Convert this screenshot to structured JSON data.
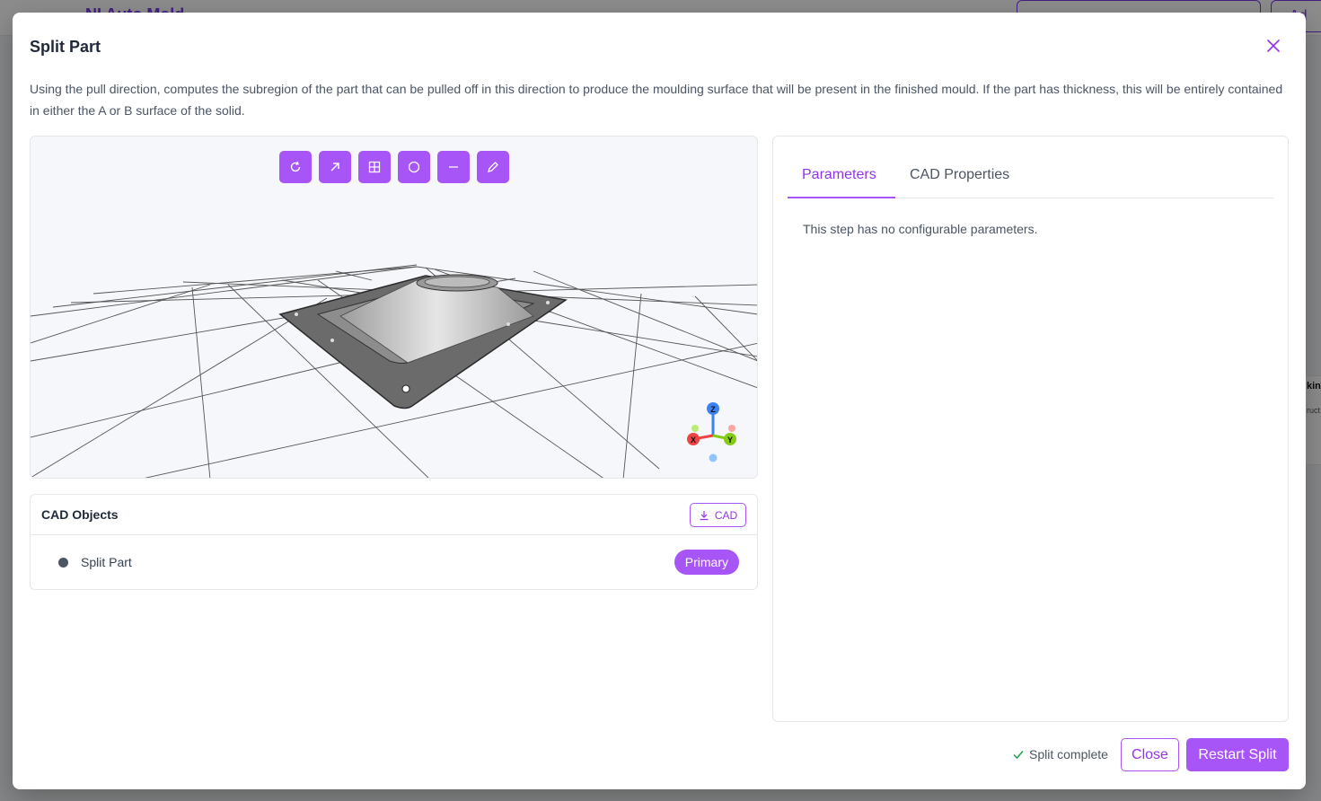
{
  "background": {
    "app_title": "NI Auto Mold",
    "add_label": "Ad",
    "side_text_1": "kin",
    "side_text_2": "ruct"
  },
  "modal": {
    "title": "Split Part",
    "description": "Using the pull direction, computes the subregion of the part that can be pulled off in this direction to produce the moulding surface that will be present in the finished mould. If the part has thickness, this will be entirely contained in either the A or B surface of the solid."
  },
  "viewer": {
    "toolbar": [
      "rotate-icon",
      "arrow-up-right-icon",
      "grid-icon",
      "circle-icon",
      "minus-icon",
      "pencil-icon"
    ],
    "axes": {
      "x": "X",
      "y": "Y",
      "z": "Z"
    }
  },
  "cad_objects": {
    "title": "CAD Objects",
    "download_label": "CAD",
    "items": [
      {
        "label": "Split Part",
        "badge": "Primary"
      }
    ]
  },
  "panel": {
    "tabs": [
      {
        "label": "Parameters",
        "active": true
      },
      {
        "label": "CAD Properties",
        "active": false
      }
    ],
    "empty_text": "This step has no configurable parameters."
  },
  "footer": {
    "status": "Split complete",
    "close_label": "Close",
    "restart_label": "Restart Split"
  },
  "colors": {
    "accent": "#a855f7",
    "accent_text": "#9333ea",
    "success": "#16a34a"
  }
}
